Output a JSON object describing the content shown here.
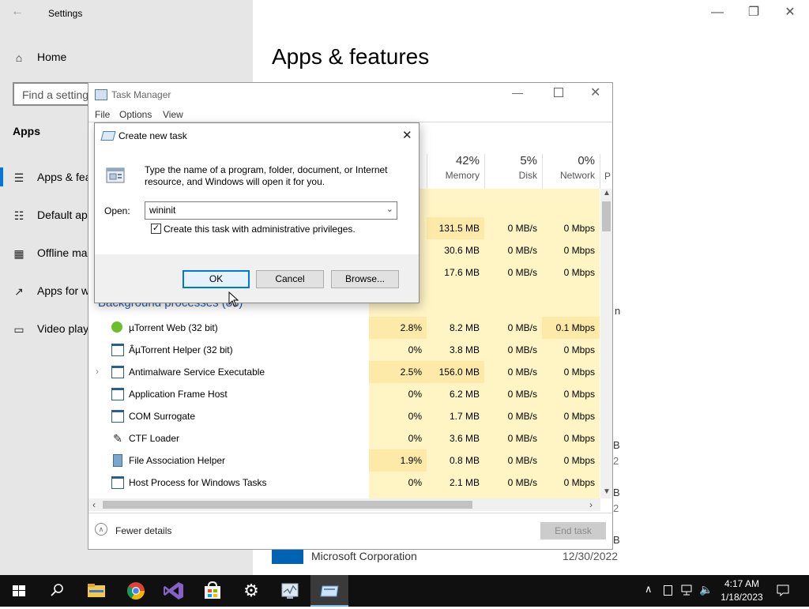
{
  "settings": {
    "title": "Settings",
    "home": "Home",
    "search_placeholder": "Find a setting",
    "section": "Apps",
    "nav": [
      "Apps & features",
      "Default apps",
      "Offline maps",
      "Apps for websites",
      "Video playback"
    ],
    "page_title": "Apps & features",
    "bottom_app_publisher": "Microsoft Corporation",
    "bottom_app_date": "12/30/2022",
    "peek_letters": [
      "n",
      "B",
      "2",
      "B",
      "2",
      "B"
    ]
  },
  "task_manager": {
    "title": "Task Manager",
    "menu": [
      "File",
      "Options",
      "View"
    ],
    "columns": [
      {
        "pct": "42%",
        "label": "Memory"
      },
      {
        "pct": "5%",
        "label": "Disk"
      },
      {
        "pct": "0%",
        "label": "Network"
      },
      {
        "pct": "",
        "label": "P"
      }
    ],
    "upper_rows": [
      {
        "mem": "131.5 MB",
        "disk": "0 MB/s",
        "net": "0 Mbps"
      },
      {
        "mem": "30.6 MB",
        "disk": "0 MB/s",
        "net": "0 Mbps"
      },
      {
        "mem": "17.6 MB",
        "disk": "0 MB/s",
        "net": "0 Mbps"
      }
    ],
    "group_label": "Background processes (88)",
    "processes": [
      {
        "name": "µTorrent Web (32 bit)",
        "icon": "utorrent-icon",
        "cpu": "2.8%",
        "mem": "8.2 MB",
        "disk": "0 MB/s",
        "net": "0.1 Mbps"
      },
      {
        "name": "ÂµTorrent Helper (32 bit)",
        "icon": "app-window-icon",
        "cpu": "0%",
        "mem": "3.8 MB",
        "disk": "0 MB/s",
        "net": "0 Mbps"
      },
      {
        "name": "Antimalware Service Executable",
        "icon": "app-window-icon",
        "cpu": "2.5%",
        "mem": "156.0 MB",
        "disk": "0 MB/s",
        "net": "0 Mbps"
      },
      {
        "name": "Application Frame Host",
        "icon": "app-window-icon",
        "cpu": "0%",
        "mem": "6.2 MB",
        "disk": "0 MB/s",
        "net": "0 Mbps"
      },
      {
        "name": "COM Surrogate",
        "icon": "app-window-icon",
        "cpu": "0%",
        "mem": "1.7 MB",
        "disk": "0 MB/s",
        "net": "0 Mbps"
      },
      {
        "name": "CTF Loader",
        "icon": "ctf-pen-icon",
        "cpu": "0%",
        "mem": "3.6 MB",
        "disk": "0 MB/s",
        "net": "0 Mbps"
      },
      {
        "name": "File Association Helper",
        "icon": "file-assoc-icon",
        "cpu": "1.9%",
        "mem": "0.8 MB",
        "disk": "0 MB/s",
        "net": "0 Mbps"
      },
      {
        "name": "Host Process for Windows Tasks",
        "icon": "app-window-icon",
        "cpu": "0%",
        "mem": "2.1 MB",
        "disk": "0 MB/s",
        "net": "0 Mbps"
      }
    ],
    "fewer_details": "Fewer details",
    "end_task": "End task"
  },
  "dialog": {
    "title": "Create new task",
    "description": "Type the name of a program, folder, document, or Internet resource, and Windows will open it for you.",
    "open_label": "Open:",
    "open_value": "wininit",
    "admin_checkbox_label": "Create this task with administrative privileges.",
    "admin_checked": true,
    "ok": "OK",
    "cancel": "Cancel",
    "browse": "Browse..."
  },
  "taskbar": {
    "time": "4:17 AM",
    "date": "1/18/2023",
    "apps": [
      "windows-start-icon",
      "search-icon",
      "file-explorer-icon",
      "chrome-icon",
      "visual-studio-icon",
      "store-icon",
      "settings-gear-icon",
      "task-manager-icon",
      "run-dialog-icon"
    ]
  },
  "colors": {
    "accent": "#0078d7",
    "heat_light": "#fff4c4",
    "heat_dark": "#fdeaa8",
    "taskbar": "#101010"
  }
}
